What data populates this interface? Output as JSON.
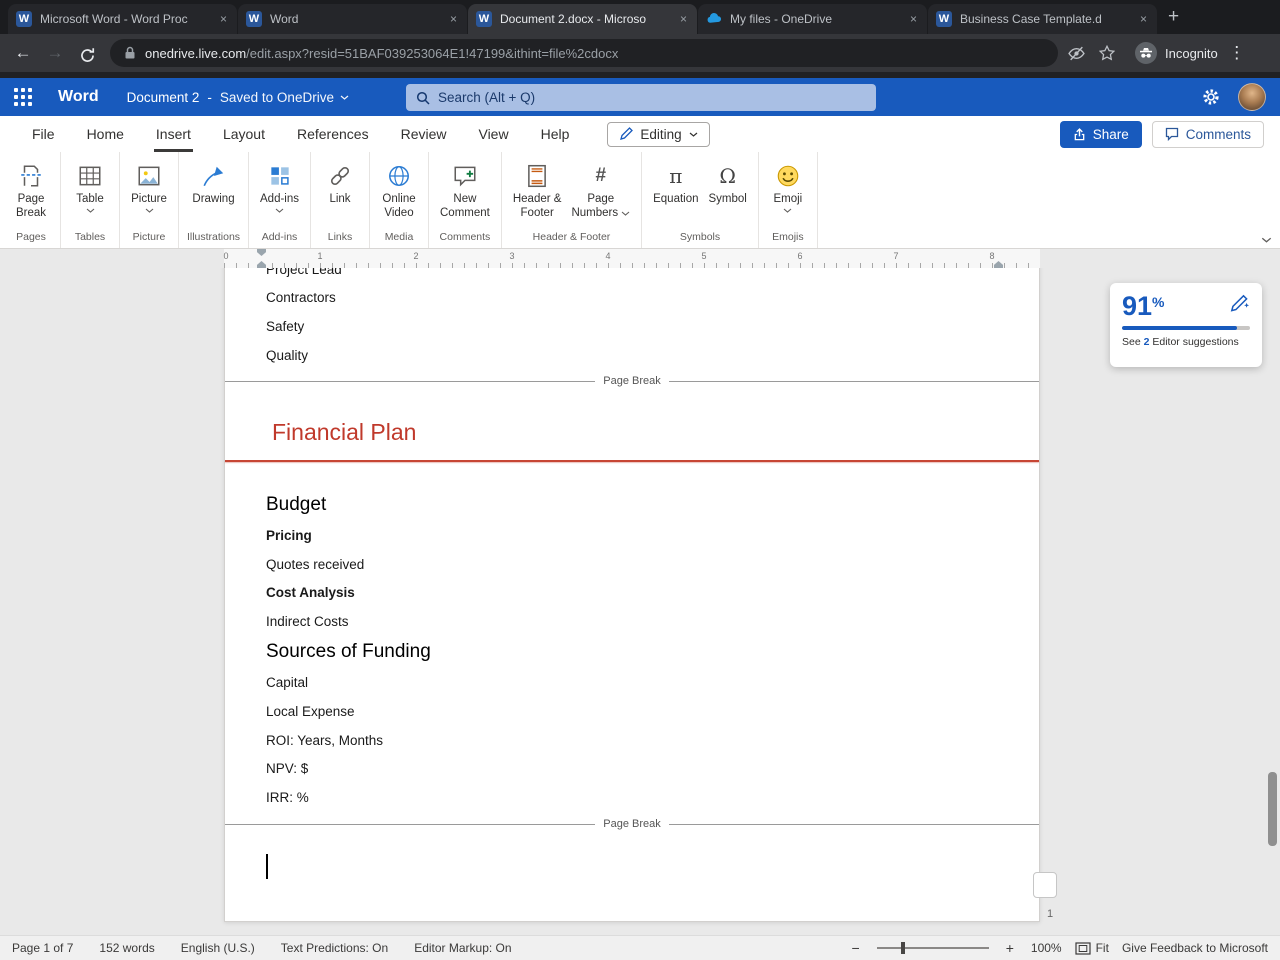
{
  "icons": {
    "back": "←",
    "forward": "→",
    "menu_dots": "⋮",
    "new_tab": "+",
    "close": "×",
    "zoom_out": "−",
    "zoom_in": "+",
    "hash": "#",
    "pi": "π",
    "omega": "Ω",
    "word_logo_letter": "W"
  },
  "browser": {
    "tabs": [
      {
        "title": "Microsoft Word - Word Proc"
      },
      {
        "title": "Word"
      },
      {
        "title": "Document 2.docx - Microso"
      },
      {
        "title": "My files - OneDrive"
      },
      {
        "title": "Business Case Template.d"
      }
    ],
    "url_host": "onedrive.live.com",
    "url_rest": "/edit.aspx?resid=51BAF039253064E1!47199&ithint=file%2cdocx",
    "incognito_label": "Incognito"
  },
  "header": {
    "app_name": "Word",
    "doc_title": "Document 2",
    "dash": "-",
    "save_status": "Saved to OneDrive",
    "search_placeholder": "Search (Alt + Q)"
  },
  "menubar": {
    "items": [
      "File",
      "Home",
      "Insert",
      "Layout",
      "References",
      "Review",
      "View",
      "Help"
    ],
    "active_item": "Insert",
    "editing_label": "Editing",
    "share_label": "Share",
    "comments_label": "Comments"
  },
  "ribbon": {
    "buttons": {
      "page_break": {
        "line1": "Page",
        "line2": "Break"
      },
      "table": {
        "line1": "Table"
      },
      "picture": {
        "line1": "Picture"
      },
      "drawing": {
        "line1": "Drawing"
      },
      "addins": {
        "line1": "Add-ins"
      },
      "link": {
        "line1": "Link"
      },
      "online_video": {
        "line1": "Online",
        "line2": "Video"
      },
      "new_comment": {
        "line1": "New",
        "line2": "Comment"
      },
      "header_footer": {
        "line1": "Header &",
        "line2": "Footer"
      },
      "page_numbers": {
        "line1": "Page",
        "line2": "Numbers"
      },
      "equation": {
        "line1": "Equation"
      },
      "symbol": {
        "line1": "Symbol"
      },
      "emoji": {
        "line1": "Emoji"
      }
    },
    "group_labels": [
      "Pages",
      "Tables",
      "Picture",
      "Illustrations",
      "Add-ins",
      "Links",
      "Media",
      "Comments",
      "Header & Footer",
      "Symbols",
      "Emojis"
    ]
  },
  "ruler": {
    "numbers": [
      "0",
      "1",
      "2",
      "3",
      "4",
      "5",
      "6",
      "7",
      "8"
    ]
  },
  "document": {
    "page_break_label": "Page Break",
    "lines_page3": [
      "Project Lead",
      "Contractors",
      "Safety",
      "Quality"
    ],
    "title": "Financial Plan",
    "lines_page4": [
      {
        "text": "Budget",
        "style": "h2"
      },
      {
        "text": "Pricing",
        "style": "bold"
      },
      {
        "text": "Quotes received",
        "style": "body"
      },
      {
        "text": "Cost Analysis",
        "style": "bold"
      },
      {
        "text": "Indirect Costs",
        "style": "body"
      },
      {
        "text": "Sources of Funding",
        "style": "h2"
      },
      {
        "text": "Capital",
        "style": "body"
      },
      {
        "text": "Local Expense",
        "style": "body"
      },
      {
        "text": "ROI: Years, Months",
        "style": "body"
      },
      {
        "text": "NPV: $",
        "style": "body"
      },
      {
        "text": "IRR: %",
        "style": "body"
      }
    ],
    "page_number_footer": "1"
  },
  "editor_panel": {
    "score": "91",
    "percent_sign": "%",
    "see_label": "See",
    "suggestion_count": "2",
    "suggestions_label": "Editor suggestions",
    "progress_percent": 90
  },
  "statusbar": {
    "page_info": "Page 1 of 7",
    "word_count": "152 words",
    "language": "English (U.S.)",
    "text_predictions": "Text Predictions: On",
    "editor_markup": "Editor Markup: On",
    "zoom_level": "100%",
    "fit_label": "Fit",
    "feedback": "Give Feedback to Microsoft"
  },
  "colors": {
    "accent_blue": "#185abd",
    "title_red": "#c0392b",
    "chrome_dark": "#202124"
  }
}
